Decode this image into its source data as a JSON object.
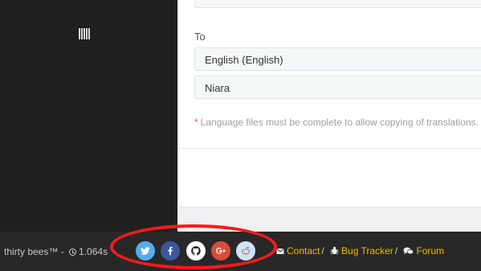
{
  "form": {
    "to_label": "To",
    "language_select_value": "English (English)",
    "theme_select_value": "Niara",
    "required_star": "*",
    "help_text": "Language files must be complete to allow copying of translations."
  },
  "footer": {
    "brand": "thirty bees™",
    "brand_sep": "-",
    "load_time": "1.064s",
    "links": [
      {
        "label": "Contact",
        "icon": "envelope-icon"
      },
      {
        "label": "Bug Tracker",
        "icon": "bug-icon"
      },
      {
        "label": "Forum",
        "icon": "comments-icon"
      }
    ],
    "link_separator": "/",
    "social": [
      {
        "name": "twitter-icon",
        "color": "#55acee"
      },
      {
        "name": "facebook-icon",
        "color": "#3b5998"
      },
      {
        "name": "github-icon",
        "color": "#ffffff"
      },
      {
        "name": "google-plus-icon",
        "color": "#dd4b39"
      },
      {
        "name": "reddit-icon",
        "color": "#cee3f8"
      }
    ]
  },
  "annotation": {
    "color": "#ff1a1a"
  }
}
